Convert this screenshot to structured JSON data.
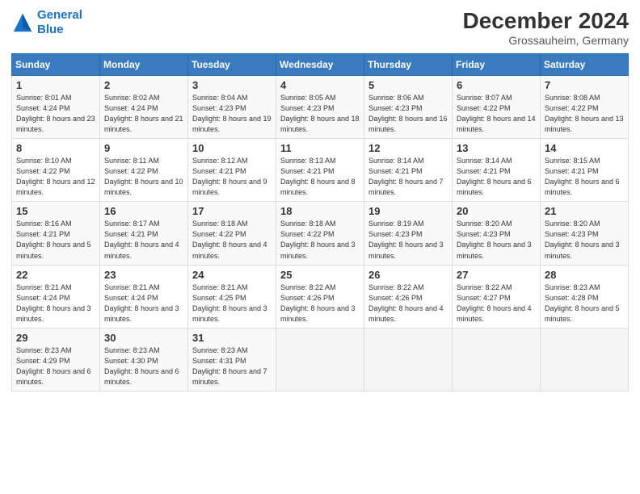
{
  "header": {
    "logo_line1": "General",
    "logo_line2": "Blue",
    "main_title": "December 2024",
    "subtitle": "Grossauheim, Germany"
  },
  "days_of_week": [
    "Sunday",
    "Monday",
    "Tuesday",
    "Wednesday",
    "Thursday",
    "Friday",
    "Saturday"
  ],
  "weeks": [
    [
      {
        "day": 1,
        "info": "Sunrise: 8:01 AM\nSunset: 4:24 PM\nDaylight: 8 hours and 23 minutes."
      },
      {
        "day": 2,
        "info": "Sunrise: 8:02 AM\nSunset: 4:24 PM\nDaylight: 8 hours and 21 minutes."
      },
      {
        "day": 3,
        "info": "Sunrise: 8:04 AM\nSunset: 4:23 PM\nDaylight: 8 hours and 19 minutes."
      },
      {
        "day": 4,
        "info": "Sunrise: 8:05 AM\nSunset: 4:23 PM\nDaylight: 8 hours and 18 minutes."
      },
      {
        "day": 5,
        "info": "Sunrise: 8:06 AM\nSunset: 4:23 PM\nDaylight: 8 hours and 16 minutes."
      },
      {
        "day": 6,
        "info": "Sunrise: 8:07 AM\nSunset: 4:22 PM\nDaylight: 8 hours and 14 minutes."
      },
      {
        "day": 7,
        "info": "Sunrise: 8:08 AM\nSunset: 4:22 PM\nDaylight: 8 hours and 13 minutes."
      }
    ],
    [
      {
        "day": 8,
        "info": "Sunrise: 8:10 AM\nSunset: 4:22 PM\nDaylight: 8 hours and 12 minutes."
      },
      {
        "day": 9,
        "info": "Sunrise: 8:11 AM\nSunset: 4:22 PM\nDaylight: 8 hours and 10 minutes."
      },
      {
        "day": 10,
        "info": "Sunrise: 8:12 AM\nSunset: 4:21 PM\nDaylight: 8 hours and 9 minutes."
      },
      {
        "day": 11,
        "info": "Sunrise: 8:13 AM\nSunset: 4:21 PM\nDaylight: 8 hours and 8 minutes."
      },
      {
        "day": 12,
        "info": "Sunrise: 8:14 AM\nSunset: 4:21 PM\nDaylight: 8 hours and 7 minutes."
      },
      {
        "day": 13,
        "info": "Sunrise: 8:14 AM\nSunset: 4:21 PM\nDaylight: 8 hours and 6 minutes."
      },
      {
        "day": 14,
        "info": "Sunrise: 8:15 AM\nSunset: 4:21 PM\nDaylight: 8 hours and 6 minutes."
      }
    ],
    [
      {
        "day": 15,
        "info": "Sunrise: 8:16 AM\nSunset: 4:21 PM\nDaylight: 8 hours and 5 minutes."
      },
      {
        "day": 16,
        "info": "Sunrise: 8:17 AM\nSunset: 4:21 PM\nDaylight: 8 hours and 4 minutes."
      },
      {
        "day": 17,
        "info": "Sunrise: 8:18 AM\nSunset: 4:22 PM\nDaylight: 8 hours and 4 minutes."
      },
      {
        "day": 18,
        "info": "Sunrise: 8:18 AM\nSunset: 4:22 PM\nDaylight: 8 hours and 3 minutes."
      },
      {
        "day": 19,
        "info": "Sunrise: 8:19 AM\nSunset: 4:23 PM\nDaylight: 8 hours and 3 minutes."
      },
      {
        "day": 20,
        "info": "Sunrise: 8:20 AM\nSunset: 4:23 PM\nDaylight: 8 hours and 3 minutes."
      },
      {
        "day": 21,
        "info": "Sunrise: 8:20 AM\nSunset: 4:23 PM\nDaylight: 8 hours and 3 minutes."
      }
    ],
    [
      {
        "day": 22,
        "info": "Sunrise: 8:21 AM\nSunset: 4:24 PM\nDaylight: 8 hours and 3 minutes."
      },
      {
        "day": 23,
        "info": "Sunrise: 8:21 AM\nSunset: 4:24 PM\nDaylight: 8 hours and 3 minutes."
      },
      {
        "day": 24,
        "info": "Sunrise: 8:21 AM\nSunset: 4:25 PM\nDaylight: 8 hours and 3 minutes."
      },
      {
        "day": 25,
        "info": "Sunrise: 8:22 AM\nSunset: 4:26 PM\nDaylight: 8 hours and 3 minutes."
      },
      {
        "day": 26,
        "info": "Sunrise: 8:22 AM\nSunset: 4:26 PM\nDaylight: 8 hours and 4 minutes."
      },
      {
        "day": 27,
        "info": "Sunrise: 8:22 AM\nSunset: 4:27 PM\nDaylight: 8 hours and 4 minutes."
      },
      {
        "day": 28,
        "info": "Sunrise: 8:23 AM\nSunset: 4:28 PM\nDaylight: 8 hours and 5 minutes."
      }
    ],
    [
      {
        "day": 29,
        "info": "Sunrise: 8:23 AM\nSunset: 4:29 PM\nDaylight: 8 hours and 6 minutes."
      },
      {
        "day": 30,
        "info": "Sunrise: 8:23 AM\nSunset: 4:30 PM\nDaylight: 8 hours and 6 minutes."
      },
      {
        "day": 31,
        "info": "Sunrise: 8:23 AM\nSunset: 4:31 PM\nDaylight: 8 hours and 7 minutes."
      },
      null,
      null,
      null,
      null
    ]
  ]
}
